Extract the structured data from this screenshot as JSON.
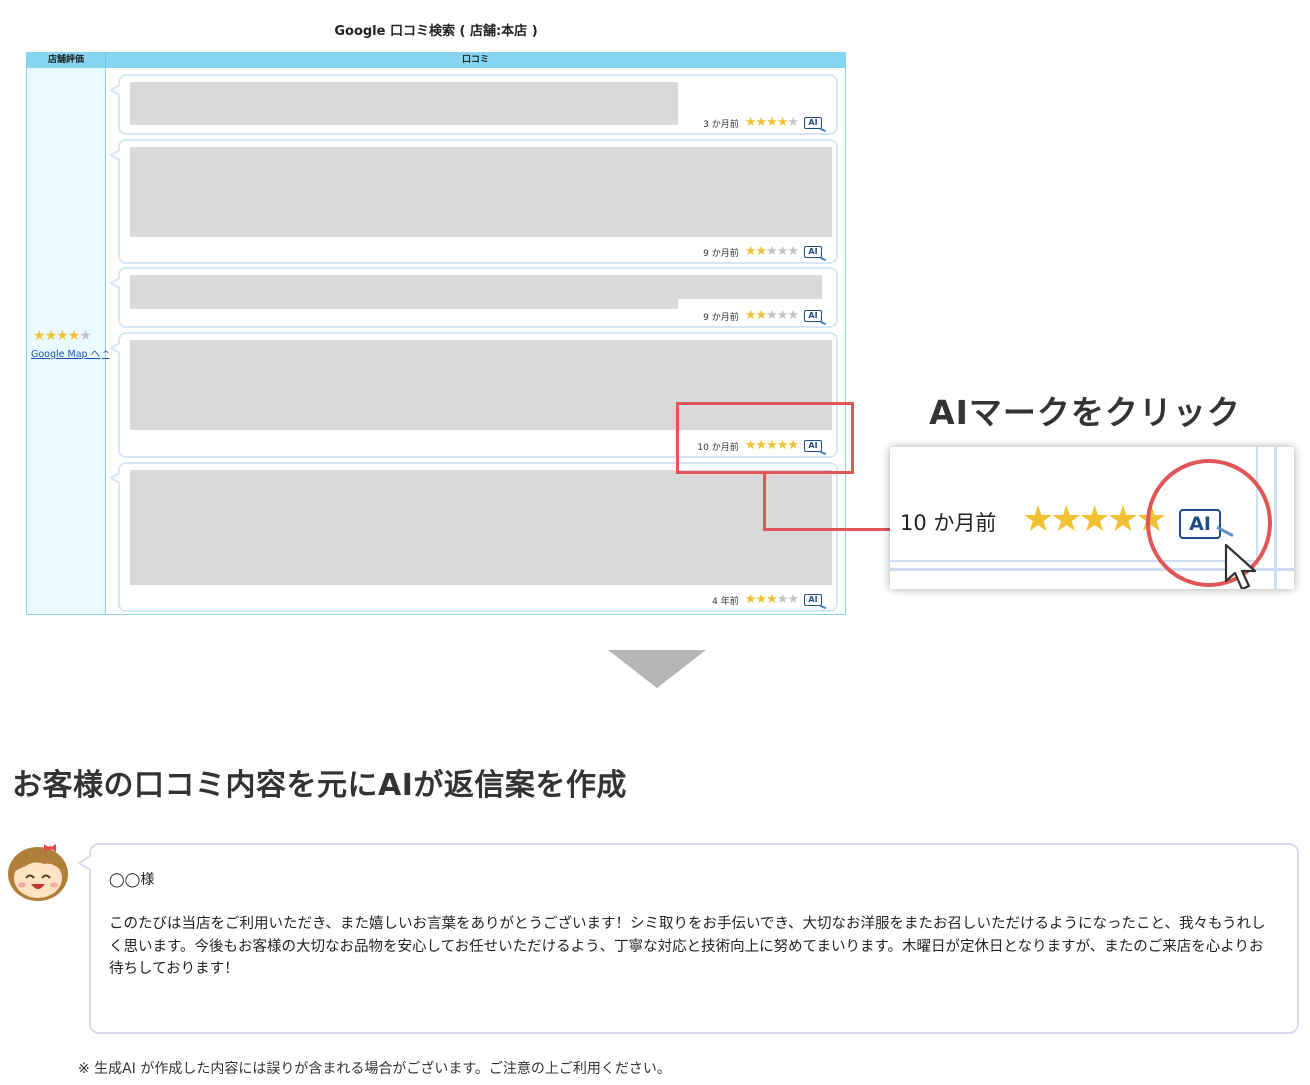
{
  "review_table": {
    "title": "Google 口コミ検索 ( 店舗:本店 )",
    "header_rating": "店舗評価",
    "header_reviews": "口コミ",
    "shop_rating_stars": 4,
    "google_map_link": "Google Map へ",
    "star_glyph": "★",
    "ai_label": "AI",
    "reviews": [
      {
        "date": "3 か月前",
        "stars": 4
      },
      {
        "date": "9 か月前",
        "stars": 2
      },
      {
        "date": "9 か月前",
        "stars": 2
      },
      {
        "date": "10 か月前",
        "stars": 5
      },
      {
        "date": "4 年前",
        "stars": 3
      }
    ]
  },
  "callout": {
    "title": "AIマークをクリック",
    "date": "10 か月前",
    "stars_text": "★★★★★",
    "ai_label": "AI"
  },
  "result": {
    "title": "お客様の口コミ内容を元にAIが返信案を作成",
    "salutation": "◯◯様",
    "body": "このたびは当店をご利用いただき、また嬉しいお言葉をありがとうございます！シミ取りをお手伝いでき、大切なお洋服をまたお召しいただけるようになったこと、我々もうれしく思います。今後もお客様の大切なお品物を安心してお任せいただけるよう、丁寧な対応と技術向上に努めてまいります。木曜日が定休日となりますが、またのご来店を心よりお待ちしております！",
    "note": "※ 生成AI が作成した内容には誤りが含まれる場合がございます。ご注意の上ご利用ください。"
  },
  "colors": {
    "header_bg": "#86d6f3",
    "left_col_bg": "#e9f9ff",
    "star_on": "#f0c233",
    "star_off": "#c4c4c4",
    "highlight_red": "#e05555",
    "ai_badge": "#1f4c86"
  }
}
